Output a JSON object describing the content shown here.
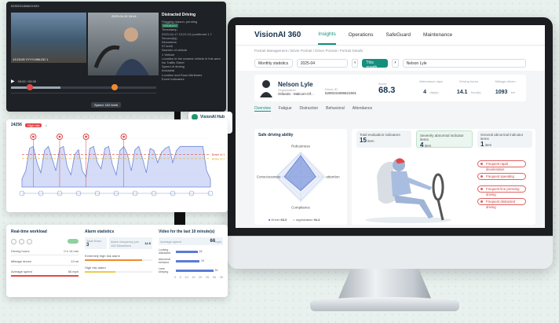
{
  "video_card": {
    "title": "5290231806621053",
    "timestamp_left": "13:23:05 YYYY-MM-DD 1",
    "timestamp_right": "2023-04-15 18:44",
    "time_display": "00:02 / 00:30",
    "speed_text": "Speed: 102 km/h",
    "event_title": "Distracted Driving",
    "event_lines": [
      "Flagging reason, pending",
      "Initialized",
      "Timestamp",
      "2023-04-17 13:22:13 (confirmed 1.7 Second(s))",
      "Kilometres",
      "97 km/h",
      "Number of vehicle",
      "1 Vehicle",
      "Location in the nearest vehicle in this area",
      "No Traffic Sheet",
      "Speed of driving",
      "Industrial",
      "Location and Road Attributes",
      "",
      "Event Indicators"
    ]
  },
  "hub": {
    "title": "VisionAI Hub",
    "button": "Not collected"
  },
  "chart_card": {
    "title": "24256",
    "badge": "High risk",
    "count": "4",
    "legend": [
      "Brake lvl 1",
      "Brake lvl 2"
    ],
    "chart_data": {
      "type": "line",
      "title": "",
      "ylim": [
        0,
        120
      ],
      "x": [
        0,
        1,
        2,
        3,
        4,
        5,
        6,
        7,
        8,
        9,
        10,
        11,
        12,
        13,
        14,
        15,
        16,
        17,
        18,
        19,
        20,
        21,
        22,
        23,
        24,
        25,
        26,
        27,
        28,
        29,
        30,
        31,
        32,
        33,
        34,
        35,
        36,
        37,
        38,
        39,
        40,
        41,
        42,
        43,
        44,
        45,
        46,
        47,
        48,
        49,
        50
      ],
      "series": [
        {
          "values": [
            20,
            40,
            95,
            100,
            60,
            35,
            90,
            100,
            70,
            40,
            95,
            100,
            50,
            30,
            80,
            92,
            40,
            25,
            95,
            100,
            60,
            45,
            95,
            100,
            55,
            30,
            90,
            100,
            80,
            40,
            92,
            100,
            70,
            35,
            95,
            90,
            60,
            85,
            95,
            100,
            60,
            90,
            100,
            100,
            100,
            100,
            100,
            100,
            100,
            40,
            20
          ]
        }
      ],
      "ref_lines": [
        80,
        70
      ],
      "event_markers": [
        3,
        10,
        17,
        27
      ]
    }
  },
  "bottom_card": {
    "workload": {
      "title": "Real-time workload",
      "rows": [
        {
          "label": "Driving hours",
          "value": "0 h 14 min"
        },
        {
          "label": "Mileage driven",
          "value": "13 mi"
        },
        {
          "label": "Average speed",
          "value": "56 mph"
        }
      ]
    },
    "alarm": {
      "title": "Alarm statistics",
      "total_label": "Total times",
      "total": "3",
      "freq_label": "Alarm frequency per 100 kilometers",
      "freq": "14.5",
      "rows": [
        {
          "label": "Extremely high risk alarm",
          "fill": 0.85,
          "color": "#f08a2c"
        },
        {
          "label": "High risk alarm",
          "fill": 0.45,
          "color": "#f2c94c"
        }
      ]
    },
    "video": {
      "title": "Video for the last 10 minute(s)",
      "speed_label": "Average speed",
      "speed_value": "66",
      "speed_unit": "mph",
      "rows": [
        {
          "label": "Looking distracted",
          "value": "18",
          "fill": 0.55
        },
        {
          "label": "Abnormal behavior",
          "value": "19",
          "fill": 0.6
        },
        {
          "label": "Lane keeping",
          "value": "30",
          "fill": 0.95
        }
      ],
      "axis": [
        "0",
        "5",
        "10",
        "15",
        "20",
        "25",
        "30",
        "35"
      ]
    }
  },
  "screen": {
    "brand": "VisionAI 360",
    "tabs": [
      "Insights",
      "Operations",
      "SafeGuard",
      "Maintenance"
    ],
    "active_tab": "Insights",
    "breadcrumb": "Portrait Management  /  Driver Portrait  /  Driver Portrait  /  Portrait Details",
    "filter": {
      "period": "Monthly statistics",
      "month": "2025-04",
      "this_month": "This month",
      "driver": "Nelson Lyle"
    },
    "profile": {
      "name": "Nelson Lyle",
      "org_label": "Organization",
      "org": "Orlando - Malcom-Of...",
      "driver_id_label": "Driver ID",
      "driver_id": "5290231806621501",
      "score_label": "Score",
      "score": "68.3",
      "stats": [
        {
          "label": "Attendance days",
          "value": "4",
          "unit": "day(s)"
        },
        {
          "label": "Driving hours",
          "value": "14.1",
          "unit": "hour(s)"
        },
        {
          "label": "Mileage driven",
          "value": "1093",
          "unit": "km"
        }
      ]
    },
    "subtabs": [
      "Overview",
      "Fatigue",
      "Distraction",
      "Behavioral",
      "Attendance"
    ],
    "radar": {
      "title": "Safe driving ability",
      "axes": [
        "Robustness",
        "attention",
        "Compliance",
        "Consciousness"
      ],
      "driver_label": "Driver",
      "driver_value": "68.3",
      "org_label": "organization",
      "org_value": "94.4",
      "chart_data": {
        "type": "radar",
        "axes": [
          "Robustness",
          "attention",
          "Compliance",
          "Consciousness"
        ],
        "series": [
          {
            "name": "Driver",
            "values": [
              85,
              60,
              55,
              65
            ]
          },
          {
            "name": "organization",
            "values": [
              95,
              92,
              94,
              96
            ]
          }
        ],
        "ylim": [
          0,
          100
        ]
      }
    },
    "kpis": [
      {
        "label": "Total evaluation indicators",
        "value": "15",
        "unit": "item"
      },
      {
        "label": "Severely abnormal indicator items",
        "value": "4",
        "unit": "item"
      },
      {
        "label": "General abnormal indicator items",
        "value": "1",
        "unit": "item"
      }
    ],
    "chips": [
      "Frequent rapid deceleration",
      "Frequent speeding",
      "Frequent line pressing driving",
      "Frequent distracted driving"
    ]
  }
}
